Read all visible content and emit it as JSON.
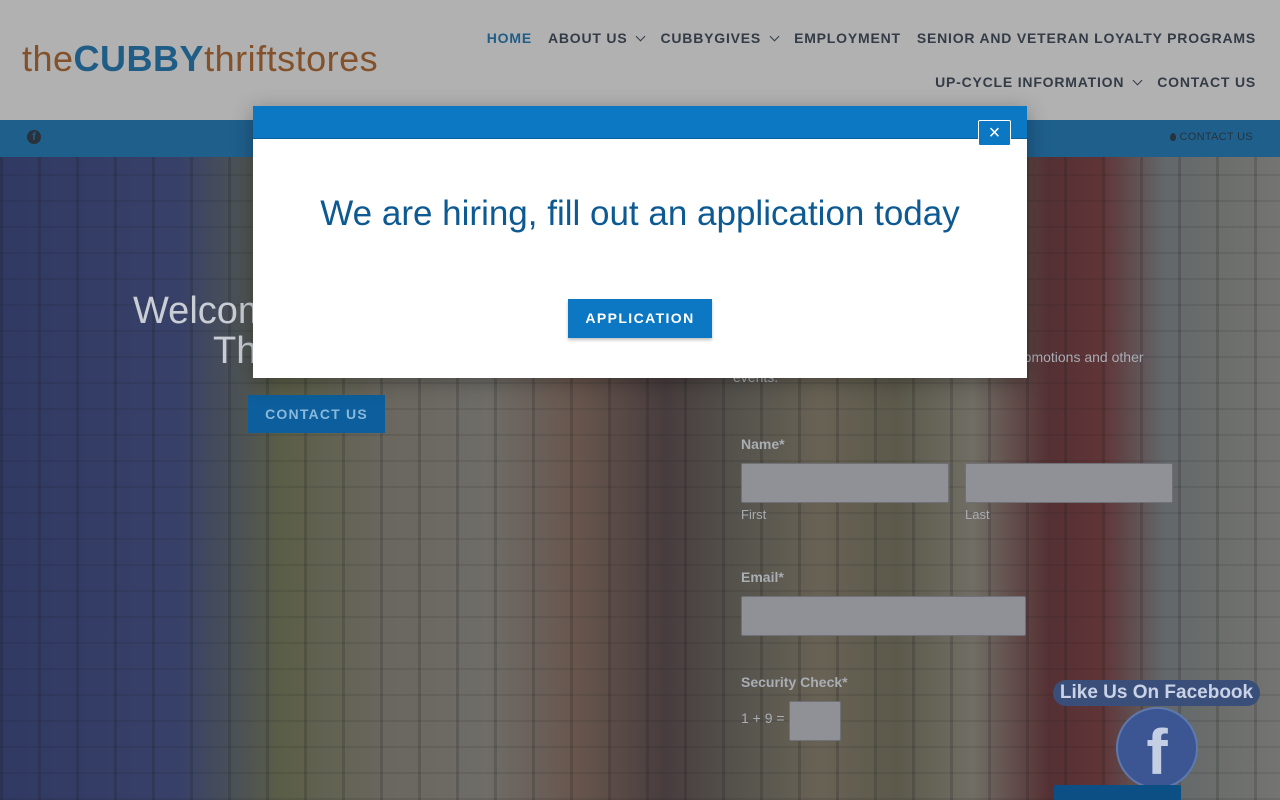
{
  "header": {
    "logo": {
      "part1": "the",
      "part2": "CUBBY",
      "part3": "thriftstores"
    },
    "nav_row1": [
      {
        "label": "HOME",
        "active": true,
        "dropdown": false
      },
      {
        "label": "ABOUT US",
        "active": false,
        "dropdown": true
      },
      {
        "label": "CUBBYGIVES",
        "active": false,
        "dropdown": true
      },
      {
        "label": "EMPLOYMENT",
        "active": false,
        "dropdown": false
      },
      {
        "label": "SENIOR AND VETERAN LOYALTY PROGRAMS",
        "active": false,
        "dropdown": false
      }
    ],
    "nav_row2": [
      {
        "label": "UP-CYCLE INFORMATION",
        "active": false,
        "dropdown": true
      },
      {
        "label": "CONTACT US",
        "active": false,
        "dropdown": false
      }
    ]
  },
  "topbar": {
    "facebook_icon": "facebook-icon",
    "contact_label": "CONTACT US"
  },
  "hero": {
    "welcome_line1": "Welcom",
    "welcome_line2": "Th",
    "contact_button": "CONTACT US",
    "newsletter_text": "romotions and other",
    "newsletter_text2": "events.",
    "form": {
      "name_label": "Name*",
      "first_label": "First",
      "last_label": "Last",
      "email_label": "Email*",
      "security_label": "Security Check*",
      "captcha_question": "1 + 9 ="
    }
  },
  "facebook_widget": {
    "label": "Like Us On Facebook",
    "icon_letter": "f"
  },
  "modal": {
    "title": "We are hiring, fill out an application today",
    "button_label": "APPLICATION",
    "close_symbol": "×"
  },
  "colors": {
    "brand_blue": "#0c77c2",
    "brand_orange": "#b35f1e",
    "title_blue": "#0d5a93"
  }
}
